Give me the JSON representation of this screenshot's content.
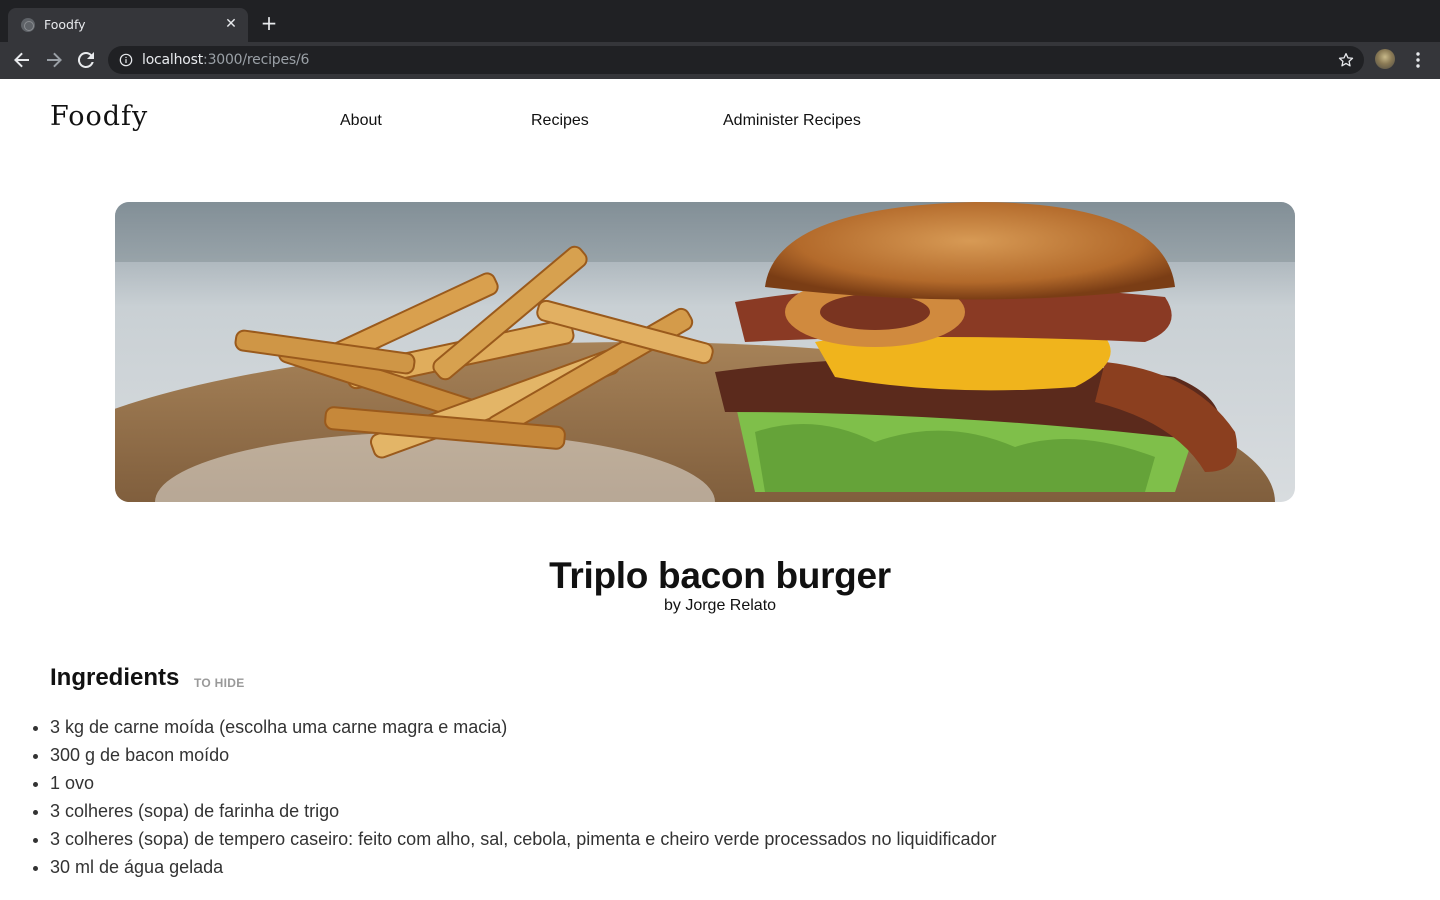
{
  "browser": {
    "tab_title": "Foodfy",
    "tab_close": "✕",
    "new_tab": "+",
    "url_host": "localhost",
    "url_path": ":3000/recipes/6"
  },
  "header": {
    "logo": "Foodfy",
    "nav": [
      {
        "label": "About"
      },
      {
        "label": "Recipes"
      },
      {
        "label": "Administer Recipes"
      }
    ]
  },
  "recipe": {
    "image_alt_icon": "burger-photo",
    "title": "Triplo bacon burger",
    "author": "by Jorge Relato",
    "ingredients_heading": "Ingredients",
    "ingredients_toggle": "TO HIDE",
    "ingredients": [
      "3 kg de carne moída (escolha uma carne magra e macia)",
      "300 g de bacon moído",
      "1 ovo",
      "3 colheres (sopa) de farinha de trigo",
      "3 colheres (sopa) de tempero caseiro: feito com alho, sal, cebola, pimenta e cheiro verde processados no liquidificador",
      "30 ml de água gelada"
    ]
  },
  "colors": {
    "chrome_dark": "#202124",
    "chrome_tab": "#35363a",
    "text": "#111111",
    "muted": "#999999"
  }
}
